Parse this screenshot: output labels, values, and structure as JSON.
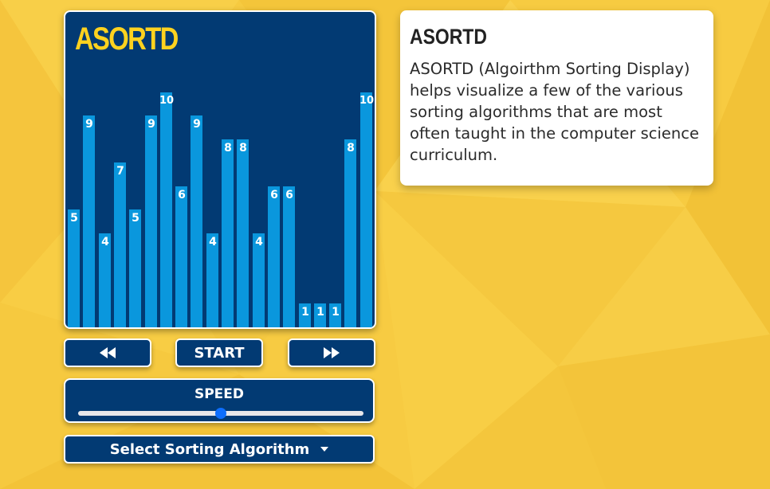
{
  "app": {
    "logo": "ASORTD"
  },
  "visualizer": {
    "bars": [
      5,
      9,
      4,
      7,
      5,
      9,
      10,
      6,
      9,
      4,
      8,
      8,
      4,
      6,
      6,
      1,
      1,
      1,
      8,
      10
    ],
    "max_value": 10,
    "bar_color": "#0a97dd",
    "panel_color": "#023a73"
  },
  "controls": {
    "back_icon": "rewind-icon",
    "start_label": "START",
    "forward_icon": "fast-forward-icon"
  },
  "speed": {
    "label": "SPEED",
    "value_fraction": 0.5
  },
  "algorithm_select": {
    "label": "Select Sorting Algorithm"
  },
  "info_card": {
    "title": "ASORTD",
    "body": "ASORTD (Algoirthm Sorting Display) helps visualize a few of the various sorting algorithms that are most often taught in the computer science curriculum."
  },
  "colors": {
    "background": "#f6c93d",
    "accent_yellow": "#ffd21f",
    "slider_thumb": "#0d6efd"
  }
}
